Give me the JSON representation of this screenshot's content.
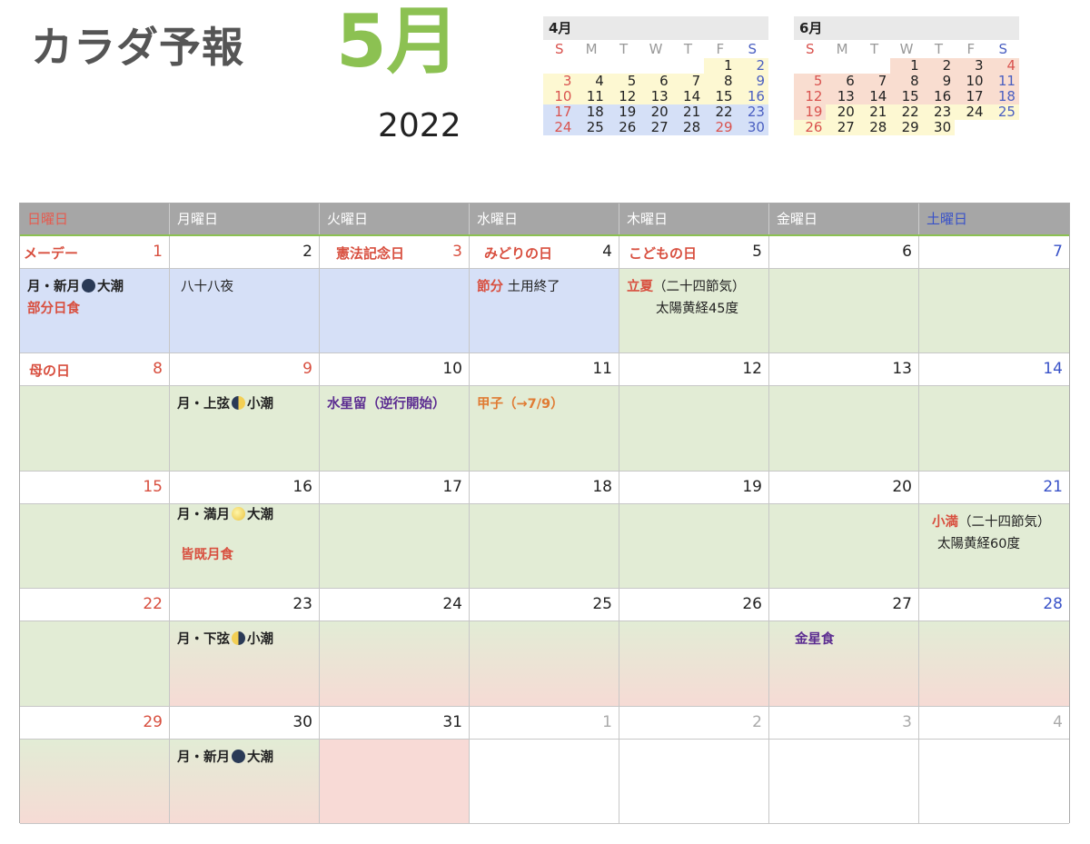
{
  "header": {
    "title": "カラダ予報",
    "month": "5月",
    "year": "2022"
  },
  "mini_april": {
    "title": "4月",
    "dow": [
      "S",
      "M",
      "T",
      "W",
      "T",
      "F",
      "S"
    ],
    "rows": [
      [
        "",
        "",
        "",
        "",
        "",
        "1",
        "2"
      ],
      [
        "3",
        "4",
        "5",
        "6",
        "7",
        "8",
        "9"
      ],
      [
        "10",
        "11",
        "12",
        "13",
        "14",
        "15",
        "16"
      ],
      [
        "17",
        "18",
        "19",
        "20",
        "21",
        "22",
        "23"
      ],
      [
        "24",
        "25",
        "26",
        "27",
        "28",
        "29",
        "30"
      ]
    ]
  },
  "mini_june": {
    "title": "6月",
    "dow": [
      "S",
      "M",
      "T",
      "W",
      "T",
      "F",
      "S"
    ],
    "rows": [
      [
        "",
        "",
        "",
        "1",
        "2",
        "3",
        "4"
      ],
      [
        "5",
        "6",
        "7",
        "8",
        "9",
        "10",
        "11"
      ],
      [
        "12",
        "13",
        "14",
        "15",
        "16",
        "17",
        "18"
      ],
      [
        "19",
        "20",
        "21",
        "22",
        "23",
        "24",
        "25"
      ],
      [
        "26",
        "27",
        "28",
        "29",
        "30",
        "",
        ""
      ]
    ]
  },
  "calendar": {
    "weekdays": [
      "日曜日",
      "月曜日",
      "火曜日",
      "水曜日",
      "木曜日",
      "金曜日",
      "土曜日"
    ],
    "weeks": [
      {
        "days": [
          "1",
          "2",
          "3",
          "4",
          "5",
          "6",
          "7"
        ],
        "holidays": [
          "メーデー",
          "",
          "憲法記念日",
          "みどりの日",
          "こどもの日",
          "",
          ""
        ],
        "events": {
          "sun_l1a": "月・新月",
          "sun_l1b": "大潮",
          "sun_l2": "部分日食",
          "mon": "八十八夜",
          "wed_a": "節分",
          "wed_b": "土用終了",
          "thu_a": "立夏",
          "thu_b": "（二十四節気）",
          "thu_c": "太陽黄経45度"
        }
      },
      {
        "days": [
          "8",
          "9",
          "10",
          "11",
          "12",
          "13",
          "14"
        ],
        "holidays": [
          "母の日",
          "",
          "",
          "",
          "",
          "",
          ""
        ],
        "events": {
          "mon_a": "月・上弦",
          "mon_b": "小潮",
          "tue": "水星留（逆行開始）",
          "wed": "甲子（→7/9）"
        }
      },
      {
        "days": [
          "15",
          "16",
          "17",
          "18",
          "19",
          "20",
          "21"
        ],
        "events": {
          "mon_a": "月・満月",
          "mon_b": "大潮",
          "mon_c": "皆既月食",
          "sat_a": "小満",
          "sat_b": "（二十四節気）",
          "sat_c": "太陽黄経60度"
        }
      },
      {
        "days": [
          "22",
          "23",
          "24",
          "25",
          "26",
          "27",
          "28"
        ],
        "events": {
          "mon_a": "月・下弦",
          "mon_b": "小潮",
          "fri": "金星食"
        }
      },
      {
        "days": [
          "29",
          "30",
          "31",
          "1",
          "2",
          "3",
          "4"
        ],
        "events": {
          "mon_a": "月・新月",
          "mon_b": "大潮"
        }
      }
    ]
  },
  "colors": {
    "accent_green": "#8cc152",
    "sunday_red": "#d84f3f",
    "saturday_blue": "#3952c8"
  }
}
